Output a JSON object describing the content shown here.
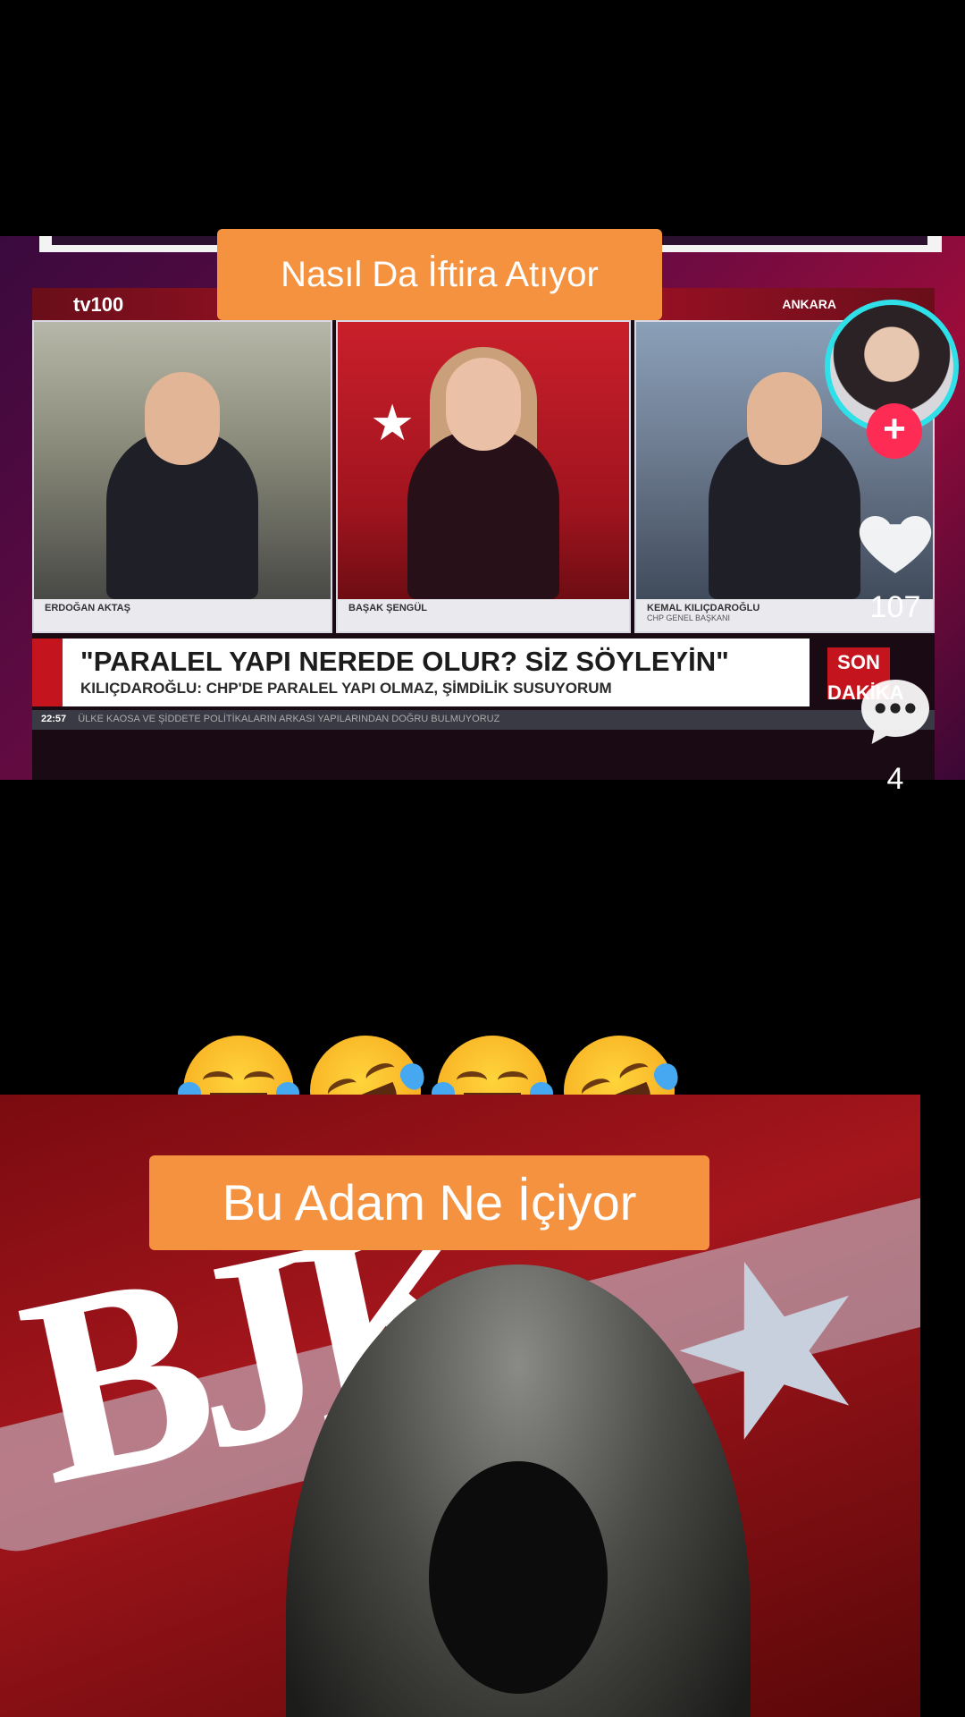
{
  "top_video": {
    "channel": "tv100",
    "breaking_label": "SON DAKİKA",
    "city": "ANKARA",
    "panels": [
      {
        "name": "ERDOĞAN AKTAŞ",
        "sub": ""
      },
      {
        "name": "BAŞAK ŞENGÜL",
        "sub": ""
      },
      {
        "name": "KEMAL KILIÇDAROĞLU",
        "sub": "CHP GENEL BAŞKANI"
      }
    ],
    "headline": "\"PARALEL YAPI NEREDE OLUR? SİZ SÖYLEYİN\"",
    "subheadline": "KILIÇDAROĞLU: CHP'DE PARALEL YAPI OLMAZ, ŞİMDİLİK SUSUYORUM",
    "ticker_tag": "SON DAKİKA",
    "ticker_time": "22:57",
    "ticker_text": "ÜLKE KAOSA VE ŞİDDETE POLİTİKALARIN ARKASI YAPILARINDAN DOĞRU BULMUYORUZ"
  },
  "captions": {
    "top": "Nasıl Da İftira Atıyor",
    "bottom": "Bu Adam Ne İçiyor"
  },
  "emojis": [
    "face-with-tears-of-joy",
    "rolling-on-floor-laughing",
    "face-with-tears-of-joy",
    "rolling-on-floor-laughing"
  ],
  "bottom_image": {
    "graffiti": "BJK"
  },
  "actions": {
    "like_count": "107",
    "comment_count": "4"
  },
  "colors": {
    "caption_bg": "#f59240",
    "follow_btn": "#fe2c55",
    "avatar_ring": "#2fe0e8"
  }
}
